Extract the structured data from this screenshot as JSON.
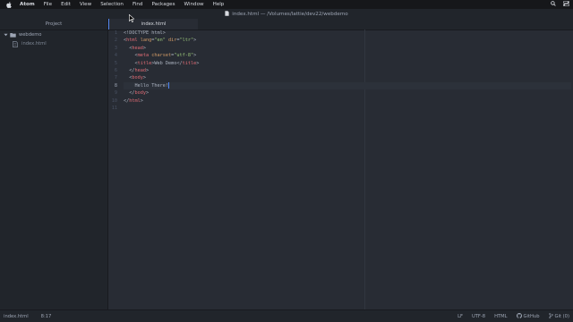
{
  "menubar": {
    "app": "Atom",
    "items": [
      "File",
      "Edit",
      "View",
      "Selection",
      "Find",
      "Packages",
      "Window",
      "Help"
    ]
  },
  "window": {
    "title": "index.html — /Volumes/lattie/dev22/webdemo"
  },
  "treeview": {
    "header": "Project",
    "root_folder": "webdemo",
    "files": [
      "index.html"
    ]
  },
  "tabs": [
    {
      "label": "index.html"
    }
  ],
  "editor": {
    "line_numbers": [
      "1",
      "2",
      "3",
      "4",
      "5",
      "6",
      "7",
      "8",
      "9",
      "10",
      "11"
    ],
    "active_line": 8
  },
  "statusbar": {
    "file": "index.html",
    "cursor_pos": "8:17",
    "line_ending": "LF",
    "encoding": "UTF-8",
    "grammar": "HTML",
    "github": "GitHub",
    "git": "Git (0)"
  }
}
